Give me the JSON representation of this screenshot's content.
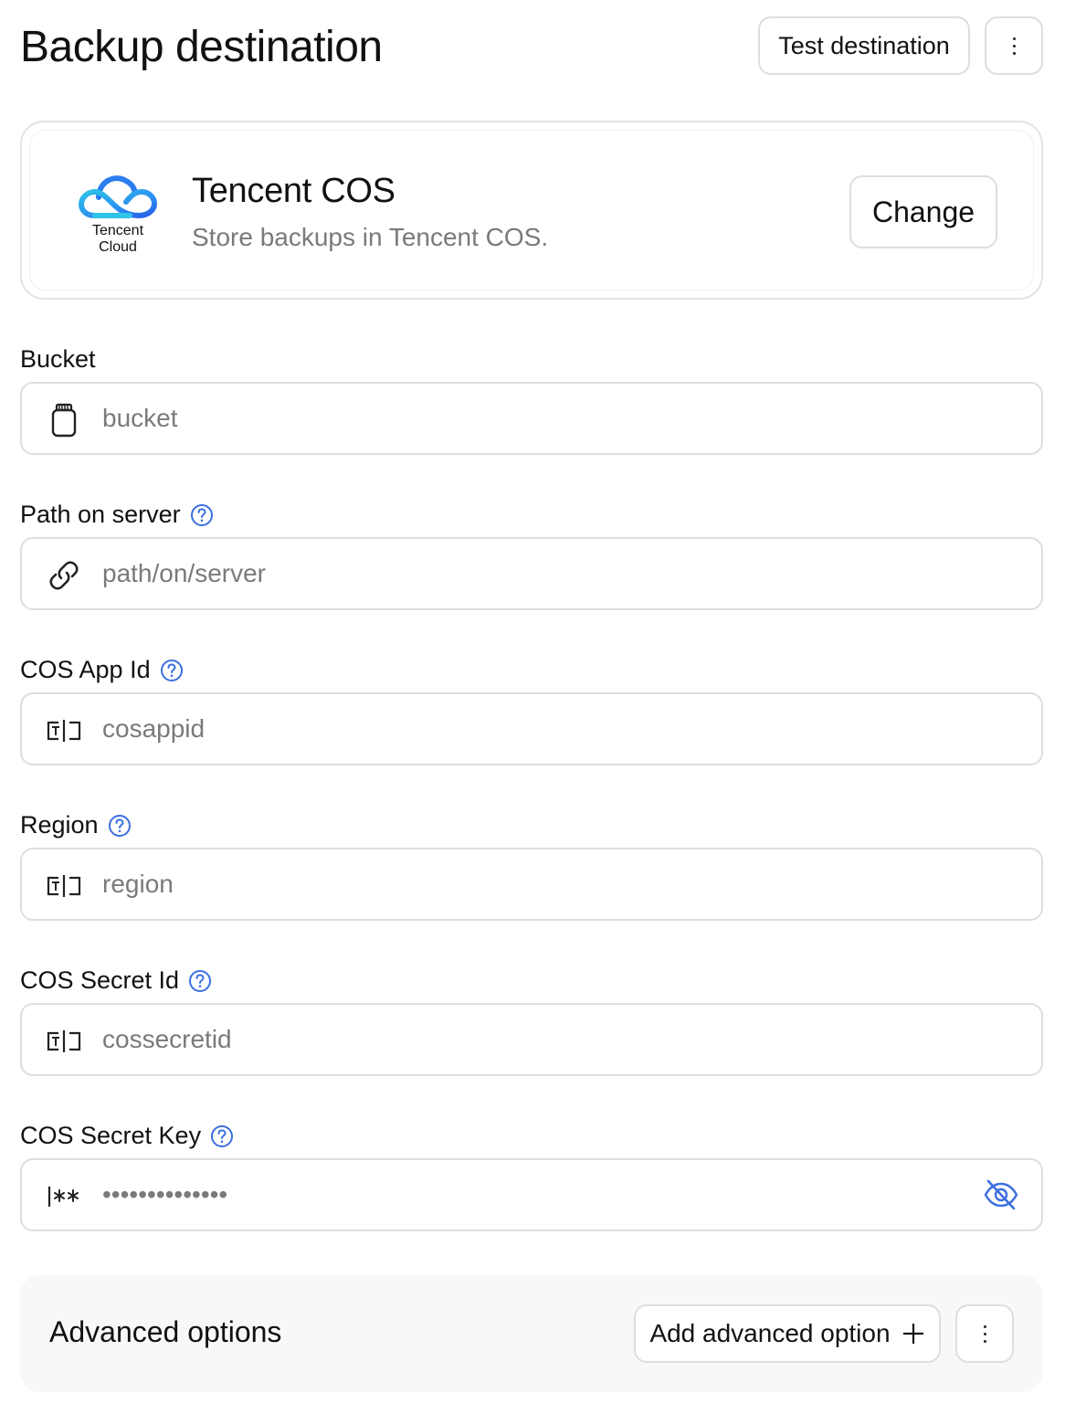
{
  "header": {
    "title": "Backup destination",
    "test_label": "Test destination"
  },
  "provider": {
    "logo_line1": "Tencent",
    "logo_line2": "Cloud",
    "name": "Tencent COS",
    "description": "Store backups in Tencent COS.",
    "change_label": "Change"
  },
  "fields": {
    "bucket": {
      "label": "Bucket",
      "placeholder": "bucket",
      "icon": "bucket-icon"
    },
    "path": {
      "label": "Path on server",
      "placeholder": "path/on/server",
      "icon": "link-icon"
    },
    "app_id": {
      "label": "COS App Id",
      "placeholder": "cosappid",
      "icon": "text-field-icon"
    },
    "region": {
      "label": "Region",
      "placeholder": "region",
      "icon": "text-field-icon"
    },
    "secret_id": {
      "label": "COS Secret Id",
      "placeholder": "cossecretid",
      "icon": "text-field-icon"
    },
    "secret_key": {
      "label": "COS Secret Key",
      "placeholder": "••••••••••••••",
      "icon": "password-icon"
    }
  },
  "advanced": {
    "title": "Advanced options",
    "add_label": "Add advanced option"
  },
  "colors": {
    "accent": "#3b6fe0",
    "border": "#dedede",
    "muted_text": "#7a7a7a",
    "advanced_bg": "#f8f8f8"
  }
}
